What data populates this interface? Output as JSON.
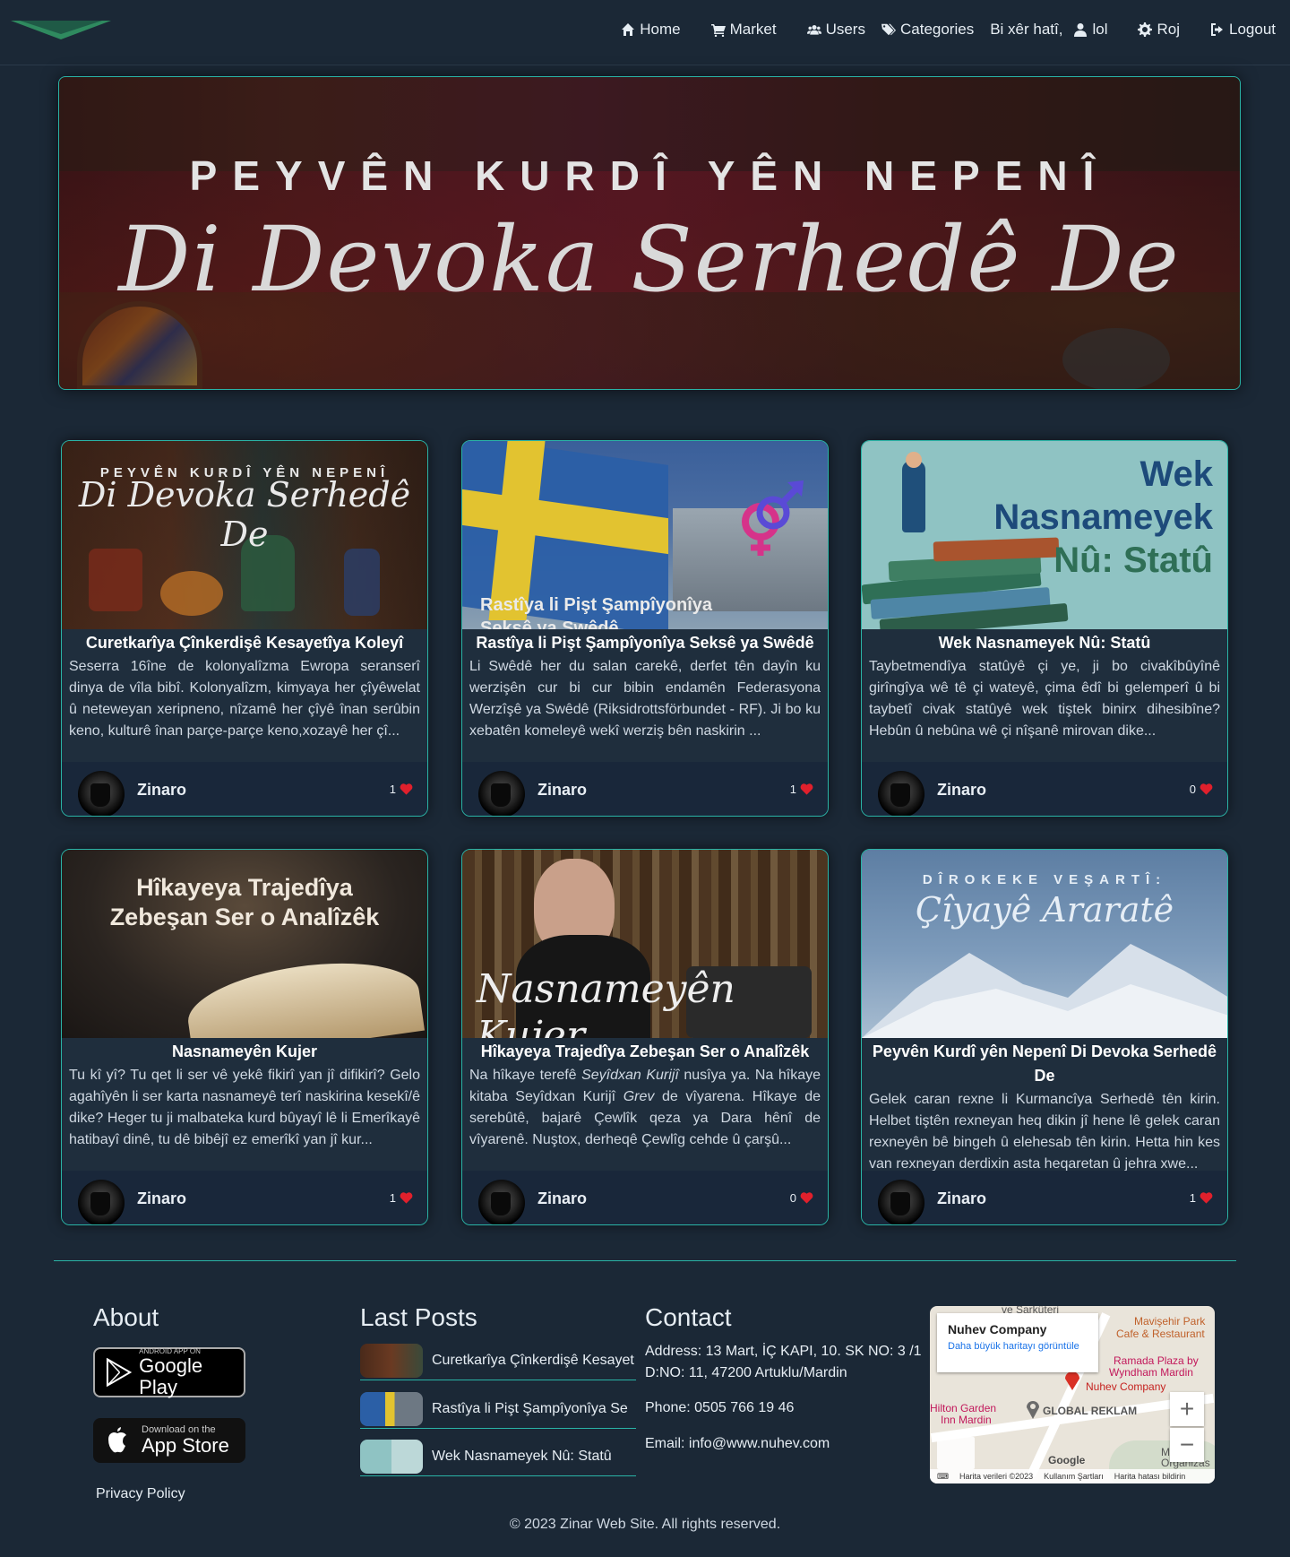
{
  "nav": {
    "home": "Home",
    "market": "Market",
    "users": "Users",
    "categories": "Categories",
    "welcome": "Bi xêr hatî,",
    "user": "lol",
    "day": "Roj",
    "logout": "Logout"
  },
  "hero": {
    "title": "PEYVÊN KURDÎ YÊN NEPENÎ",
    "script": "Di Devoka Serhedê De"
  },
  "cards": [
    {
      "img_line1": "PEYVÊN KURDÎ YÊN NEPENÎ",
      "img_line2": "Di Devoka Serhedê De",
      "title": "Curetkarîya Çînkerdişê Kesayetîya Koleyî",
      "text": "Seserra 16îne de kolonyalîzma Ewropa seranserî dinya de vîla bibî. Kolonyalîzm, kimyaya her çîyêwelat û neteweyan xeripneno, nîzamê her çîyê înan serûbin keno, kulturê înan parçe-parçe keno,xozayê her çî...",
      "author": "Zinaro",
      "likes": "1"
    },
    {
      "img_line1": "Rastîya li Pişt Şampîyonîya",
      "img_line2": "Seksê ya Swêdê",
      "title": "Rastîya li Pişt Şampîyonîya Seksê ya Swêdê",
      "text": "Li Swêdê her du salan carekê, derfet tên dayîn ku werzişên cur bi cur bibin endamên Federasyona Werzîşê ya Swêdê (Riksidrottsförbundet - RF). Ji bo ku xebatên komeleyê wekî werziş bên naskirin ...",
      "author": "Zinaro",
      "likes": "1"
    },
    {
      "img_line1": "Wek",
      "img_line2": "Nasnameyek",
      "img_line3": "Nû: Statû",
      "title": "Wek Nasnameyek Nû: Statû",
      "text": "Taybetmendîya statûyê çi ye, ji bo civakîbûyînê girîngîya wê tê çi wateyê, çima êdî bi gelemperî û bi taybetî civak statûyê wek tiştek binirx dihesibîne? Hebûn û nebûna wê çi nîşanê mirovan dike...",
      "author": "Zinaro",
      "likes": "0"
    },
    {
      "img_line1": "Hîkayeya Trajedîya",
      "img_line2": "Zebeşan Ser o Analîzêk",
      "title": "Nasnameyên Kujer",
      "text": "Tu kî yî? Tu qet li ser vê yekê fikirî yan jî difikirî? Gelo agahîyên li ser karta nasnameyê terî naskirina kesekî/ê dike? Heger tu ji malbateka kurd bûyayî lê li Emerîkayê hatibayî dinê, tu dê bibêjî ez emerîkî yan jî kur...",
      "author": "Zinaro",
      "likes": "1"
    },
    {
      "img_line1": "Nasnameyên",
      "img_line2": "Kujer",
      "title": "Hîkayeya Trajedîya Zebeşan Ser o Analîzêk",
      "text_before": "Na hîkaye terefê ",
      "text_em1": "Seyîdxan Kurijî",
      "text_mid": " nusîya ya. Na hîkaye kitaba Seyîdxan Kurijî ",
      "text_em2": "Grev",
      "text_after": " de vîyarena. Hîkaye de serebûtê, bajarê Çewlîk qeza ya Dara hênî de vîyarenê. Nuştox, derheqê Çewlîg cehde û çarşû...",
      "author": "Zinaro",
      "likes": "0"
    },
    {
      "img_line1": "DÎROKEKE VEŞARTÎ:",
      "img_line2": "Çîyayê Araratê",
      "title": "Peyvên Kurdî yên Nepenî Di Devoka Serhedê De",
      "text": "Gelek caran rexne li Kurmancîya Serhedê tên kirin. Helbet tiştên rexneyan heq dikin jî hene lê gelek caran rexneyên bê bingeh û elehesab tên kirin. Hetta hin kes van rexneyan derdixin asta heqaretan û jehra xwe...",
      "author": "Zinaro",
      "likes": "1"
    }
  ],
  "footer": {
    "about": "About",
    "google_small": "ANDROID APP ON",
    "google_big": "Google Play",
    "apple_small": "Download on the",
    "apple_big": "App Store",
    "privacy": "Privacy Policy",
    "last_posts": "Last Posts",
    "posts": [
      "Curetkarîya Çînkerdişê Kesayet",
      "Rastîya li Pişt Şampîyonîya Se",
      "Wek Nasnameyek Nû: Statû"
    ],
    "contact": "Contact",
    "address": "Address: 13 Mart, İÇ KAPI, 10. SK NO: 3 /1 D:NO: 11, 47200 Artuklu/Mardin",
    "phone": "Phone: 0505 766 19 46",
    "email": "Email: info@www.nuhev.com",
    "copyright": "© 2023 Zinar Web Site. All rights reserved."
  },
  "map": {
    "company": "Nuhev Company",
    "link": "Daha büyük haritayı görüntüle",
    "labels": {
      "sarkuteri": "ve Şarküteri",
      "mavisehir": "Mavişehir Park",
      "cafe": "Cafe & Restaurant",
      "ramada": "Ramada Plaza by",
      "wyndham": "Wyndham Mardin",
      "nuhev": "Nuhev Company",
      "hilton": "Hilton Garden",
      "inn": "Inn Mardin",
      "global": "GLOBAL REKLAM",
      "google": "Google",
      "m": "M",
      "org": "Organizas"
    },
    "attribution": "Harita verileri ©2023",
    "terms": "Kullanım Şartları",
    "report": "Harita hatası bildirin"
  }
}
